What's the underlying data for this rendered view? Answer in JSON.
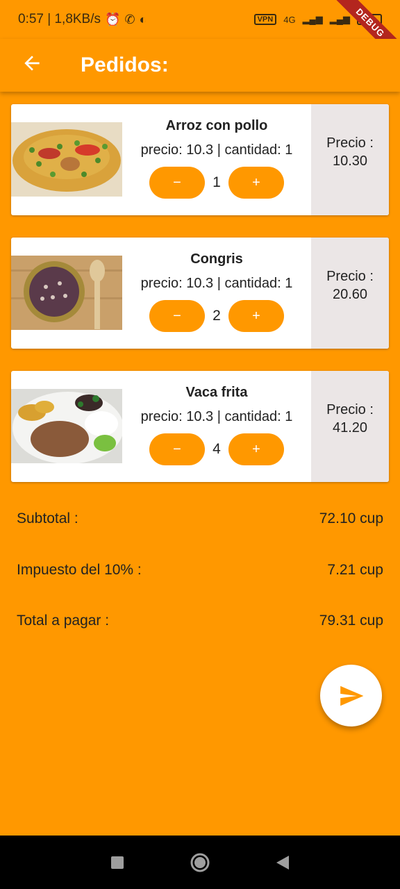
{
  "status_bar": {
    "time_speed": "0:57 | 1,8KB/s",
    "vpn_label": "VPN",
    "network_label": "4G",
    "battery_level": "60"
  },
  "debug_banner": "DEBUG",
  "app_bar": {
    "back_icon": "arrow-back-icon",
    "title": "Pedidos:"
  },
  "orders": [
    {
      "name": "Arroz con pollo",
      "details": "precio: 10.3 | cantidad: 1",
      "quantity": "1",
      "price_label": "Precio :",
      "price_value": "10.30",
      "minus": "−",
      "plus": "+"
    },
    {
      "name": "Congris",
      "details": "precio: 10.3 | cantidad: 1",
      "quantity": "2",
      "price_label": "Precio :",
      "price_value": "20.60",
      "minus": "−",
      "plus": "+"
    },
    {
      "name": "Vaca frita",
      "details": "precio: 10.3 | cantidad: 1",
      "quantity": "4",
      "price_label": "Precio :",
      "price_value": "41.20",
      "minus": "−",
      "plus": "+"
    }
  ],
  "summary": {
    "subtotal_label": "Subtotal :",
    "subtotal_value": "72.10 cup",
    "tax_label": "Impuesto del 10% :",
    "tax_value": "7.21 cup",
    "total_label": "Total a pagar :",
    "total_value": "79.31 cup"
  },
  "fab_icon": "send-icon",
  "colors": {
    "primary": "#FF9800",
    "card": "#FFFFFF",
    "price_panel": "#EBE6E6"
  }
}
